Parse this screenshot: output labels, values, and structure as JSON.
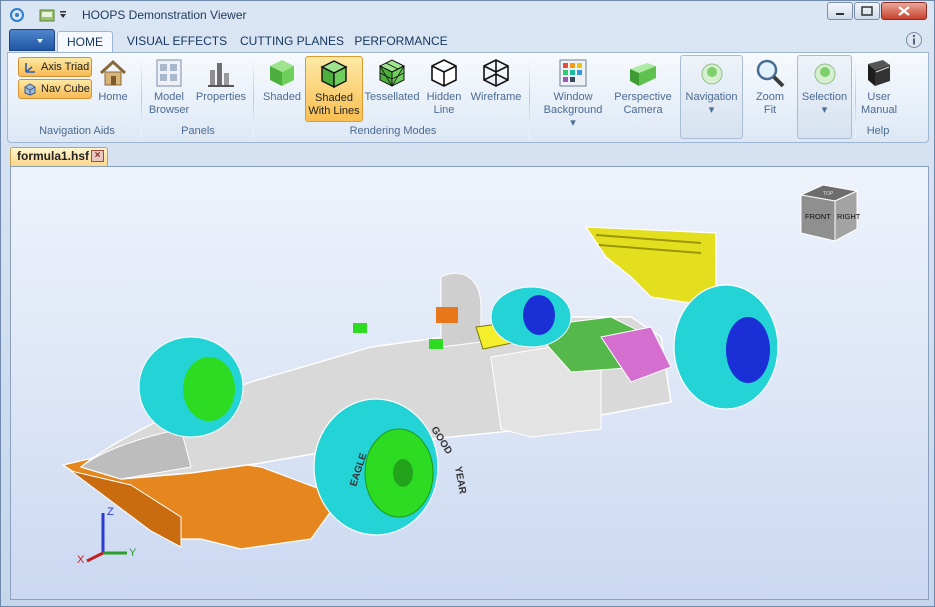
{
  "window": {
    "title": "HOOPS Demonstration Viewer",
    "controls": [
      "minimize",
      "maximize",
      "close"
    ]
  },
  "tabs": [
    {
      "label": "HOME",
      "active": true
    },
    {
      "label": "VISUAL EFFECTS",
      "active": false
    },
    {
      "label": "CUTTING PLANES",
      "active": false
    },
    {
      "label": "PERFORMANCE",
      "active": false
    }
  ],
  "groups": {
    "navigation_aids": {
      "label": "Navigation Aids",
      "axis_triad": "Axis Triad",
      "nav_cube": "Nav Cube",
      "home": "Home"
    },
    "panels": {
      "label": "Panels",
      "model_browser_1": "Model",
      "model_browser_2": "Browser",
      "properties": "Properties"
    },
    "rendering_modes": {
      "label": "Rendering Modes",
      "shaded": "Shaded",
      "shaded_lines_1": "Shaded",
      "shaded_lines_2": "With Lines",
      "tessellated": "Tessellated",
      "hidden_line_1": "Hidden",
      "hidden_line_2": "Line",
      "wireframe": "Wireframe"
    },
    "view": {
      "window_bg_1": "Window",
      "window_bg_2": "Background",
      "perspective_1": "Perspective",
      "perspective_2": "Camera",
      "navigation": "Navigation",
      "zoom_fit_1": "Zoom",
      "zoom_fit_2": "Fit",
      "selection": "Selection"
    },
    "help": {
      "label": "Help",
      "user_manual_1": "User",
      "user_manual_2": "Manual"
    }
  },
  "document": {
    "tab_label": "formula1.hsf"
  },
  "nav_cube": {
    "front": "FRONT",
    "right": "RIGHT",
    "top": "TOP"
  },
  "axis": {
    "x": "X",
    "y": "Y",
    "z": "Z"
  },
  "tire_text": {
    "sidewall_1": "GOOD",
    "sidewall_2": "YEAR",
    "brand": "EAGLE"
  },
  "colors": {
    "accent_selected": "#f9bf52",
    "tire": "#23d3d6",
    "rim": "#2ddb22",
    "hub": "#1a2fd6",
    "body": "#d9d9d9",
    "front_wing": "#e5871e",
    "rear_wing": "#e4df1e"
  }
}
